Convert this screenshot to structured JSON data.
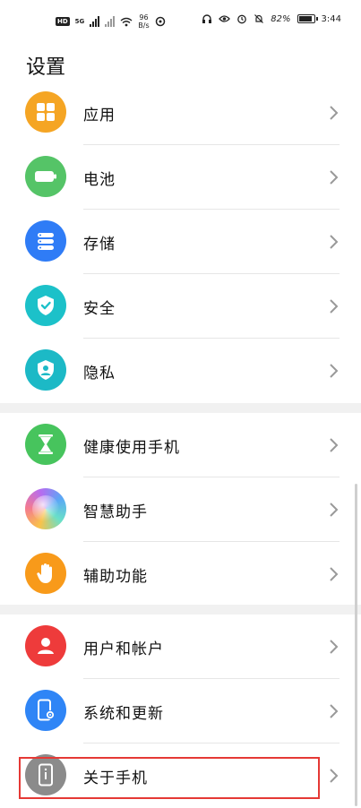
{
  "statusbar": {
    "net_gen": "5G",
    "speed_value": "96",
    "speed_unit": "B/s",
    "battery_percent": "82%",
    "battery_level": 0.82,
    "time": "3:44"
  },
  "page": {
    "title": "设置"
  },
  "colors": {
    "apps": "#f5a524",
    "battery": "#55c467",
    "storage": "#2f7cf6",
    "security": "#1cc1c9",
    "privacy": "#1cb9c6",
    "health": "#47c45d",
    "assistant": "#f7b733",
    "accessibility": "#f89a1a",
    "accounts": "#ee3b3b",
    "system": "#2f85f6",
    "about": "#8b8b8b",
    "highlight": "#e53935"
  },
  "groups": [
    {
      "items": [
        {
          "label": "应用",
          "icon": "apps-icon"
        },
        {
          "label": "电池",
          "icon": "battery-icon"
        },
        {
          "label": "存储",
          "icon": "storage-icon"
        },
        {
          "label": "安全",
          "icon": "shield-check-icon"
        },
        {
          "label": "隐私",
          "icon": "privacy-icon"
        }
      ]
    },
    {
      "items": [
        {
          "label": "健康使用手机",
          "icon": "hourglass-icon"
        },
        {
          "label": "智慧助手",
          "icon": "assistant-icon"
        },
        {
          "label": "辅助功能",
          "icon": "hand-icon"
        }
      ]
    },
    {
      "items": [
        {
          "label": "用户和帐户",
          "icon": "user-icon"
        },
        {
          "label": "系统和更新",
          "icon": "phone-settings-icon"
        },
        {
          "label": "关于手机",
          "icon": "info-phone-icon"
        }
      ]
    }
  ]
}
